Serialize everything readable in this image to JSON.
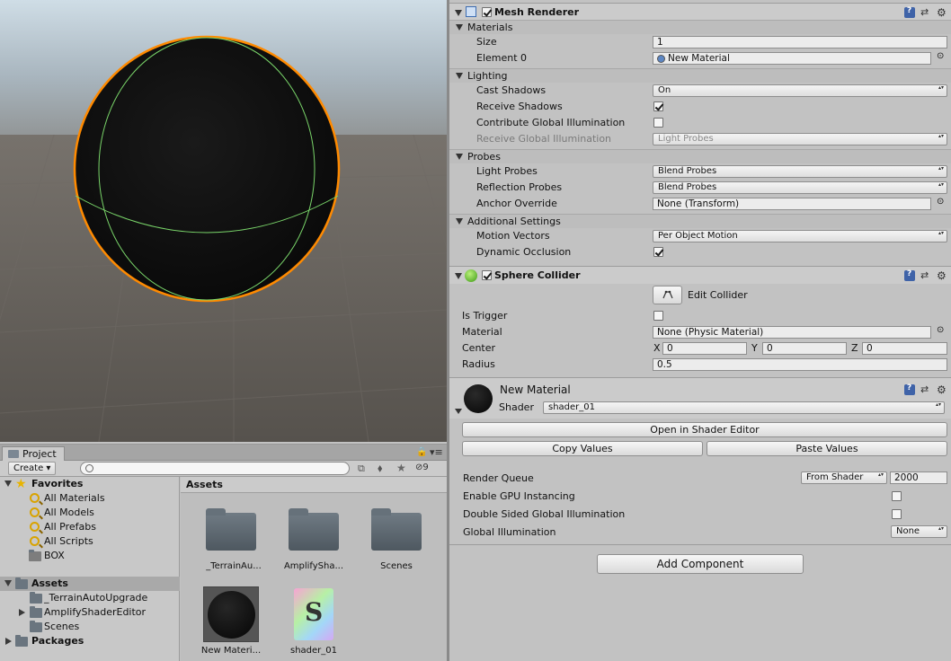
{
  "project": {
    "tab_label": "Project",
    "create_label": "Create",
    "search_placeholder": "",
    "hidden_count": "9",
    "tree": {
      "favorites_label": "Favorites",
      "favorites": [
        "All Materials",
        "All Models",
        "All Prefabs",
        "All Scripts",
        "BOX"
      ],
      "assets_label": "Assets",
      "assets_children": [
        "_TerrainAutoUpgrade",
        "AmplifyShaderEditor",
        "Scenes"
      ],
      "packages_label": "Packages"
    },
    "grid": {
      "header": "Assets",
      "items": [
        "_TerrainAu...",
        "AmplifySha...",
        "Scenes",
        "New Materi...",
        "shader_01"
      ]
    }
  },
  "inspector": {
    "mesh_renderer": {
      "title": "Mesh Renderer",
      "materials_section": "Materials",
      "size_label": "Size",
      "size_value": "1",
      "element0_label": "Element 0",
      "element0_value": "New Material",
      "lighting_section": "Lighting",
      "cast_shadows_label": "Cast Shadows",
      "cast_shadows_value": "On",
      "receive_shadows_label": "Receive Shadows",
      "contribute_gi_label": "Contribute Global Illumination",
      "receive_gi_label": "Receive Global Illumination",
      "receive_gi_value": "Light Probes",
      "probes_section": "Probes",
      "light_probes_label": "Light Probes",
      "light_probes_value": "Blend Probes",
      "reflection_probes_label": "Reflection Probes",
      "reflection_probes_value": "Blend Probes",
      "anchor_override_label": "Anchor Override",
      "anchor_override_value": "None (Transform)",
      "additional_section": "Additional Settings",
      "motion_vectors_label": "Motion Vectors",
      "motion_vectors_value": "Per Object Motion",
      "dynamic_occlusion_label": "Dynamic Occlusion"
    },
    "sphere_collider": {
      "title": "Sphere Collider",
      "edit_collider_label": "Edit Collider",
      "is_trigger_label": "Is Trigger",
      "material_label": "Material",
      "material_value": "None (Physic Material)",
      "center_label": "Center",
      "x_label": "X",
      "x_value": "0",
      "y_label": "Y",
      "y_value": "0",
      "z_label": "Z",
      "z_value": "0",
      "radius_label": "Radius",
      "radius_value": "0.5"
    },
    "material": {
      "name": "New Material",
      "shader_label": "Shader",
      "shader_value": "shader_01",
      "open_shader_editor": "Open in Shader Editor",
      "copy_values": "Copy Values",
      "paste_values": "Paste Values",
      "render_queue_label": "Render Queue",
      "render_queue_mode": "From Shader",
      "render_queue_value": "2000",
      "gpu_instancing_label": "Enable GPU Instancing",
      "double_sided_gi_label": "Double Sided Global Illumination",
      "global_illumination_label": "Global Illumination",
      "global_illumination_value": "None"
    },
    "add_component": "Add Component"
  }
}
